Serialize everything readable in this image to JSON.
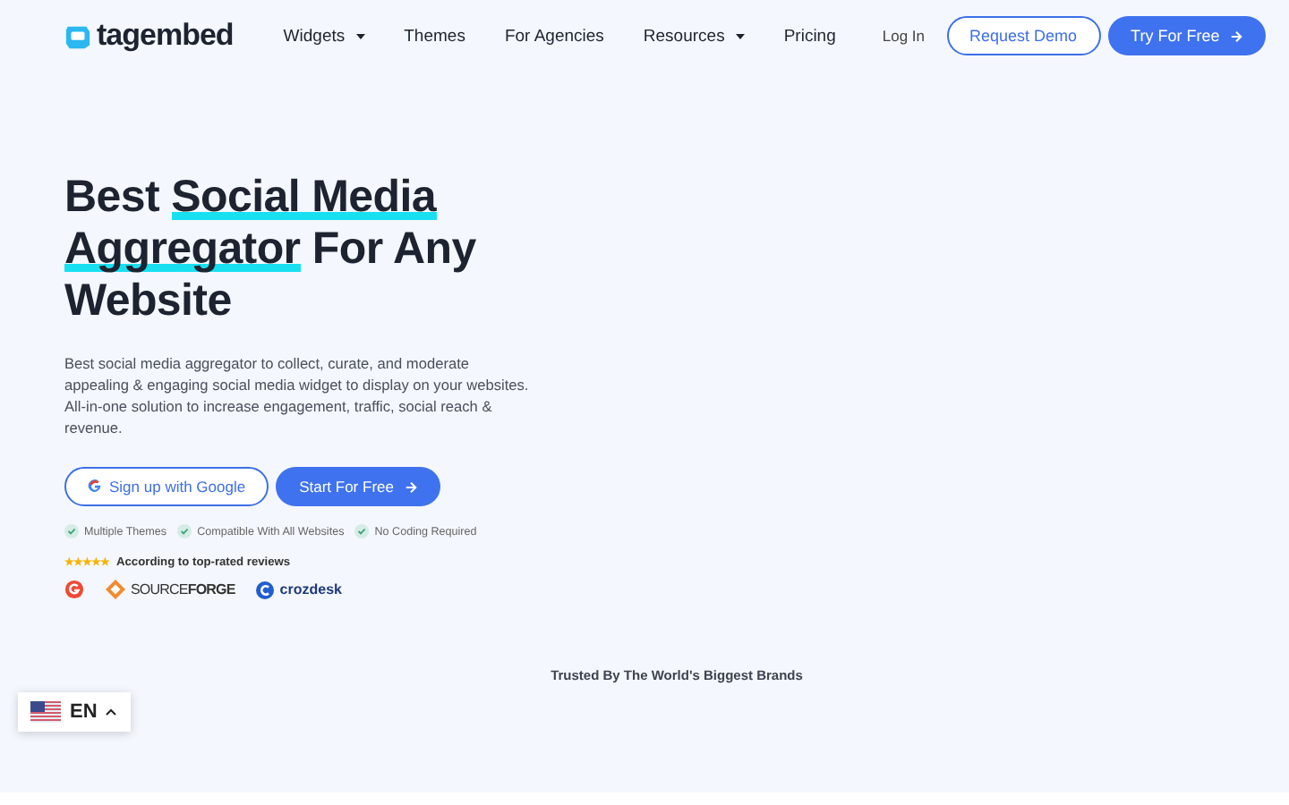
{
  "nav": {
    "logo": "tagembed",
    "items": [
      {
        "label": "Widgets",
        "dropdown": true
      },
      {
        "label": "Themes",
        "dropdown": false
      },
      {
        "label": "For Agencies",
        "dropdown": false
      },
      {
        "label": "Resources",
        "dropdown": true
      },
      {
        "label": "Pricing",
        "dropdown": false
      }
    ],
    "login": "Log In",
    "demo": "Request Demo",
    "try": "Try For Free"
  },
  "hero": {
    "headline": [
      {
        "text": "Best",
        "highlight": false
      },
      {
        "text": "Social Media",
        "highlight": true
      },
      {
        "text": "Aggregator",
        "highlight": true
      },
      {
        "text": "For Any Website",
        "highlight": false
      }
    ],
    "description": "Best social media aggregator to collect, curate, and moderate appealing & engaging social media widget to display on your websites. All-in-one solution to increase engagement, traffic, social reach & revenue.",
    "google_button": "Sign up with Google",
    "start_button": "Start For Free",
    "features": [
      "Multiple Themes",
      "Compatible With All Websites",
      "No Coding Required"
    ],
    "rating": {
      "stars": 5,
      "text": "According to top-rated reviews"
    },
    "brands": [
      "SOURCE**FORGE**",
      "crozdesk"
    ]
  },
  "trusted": "Trusted By The World's Biggest Brands",
  "language": {
    "code": "EN"
  }
}
